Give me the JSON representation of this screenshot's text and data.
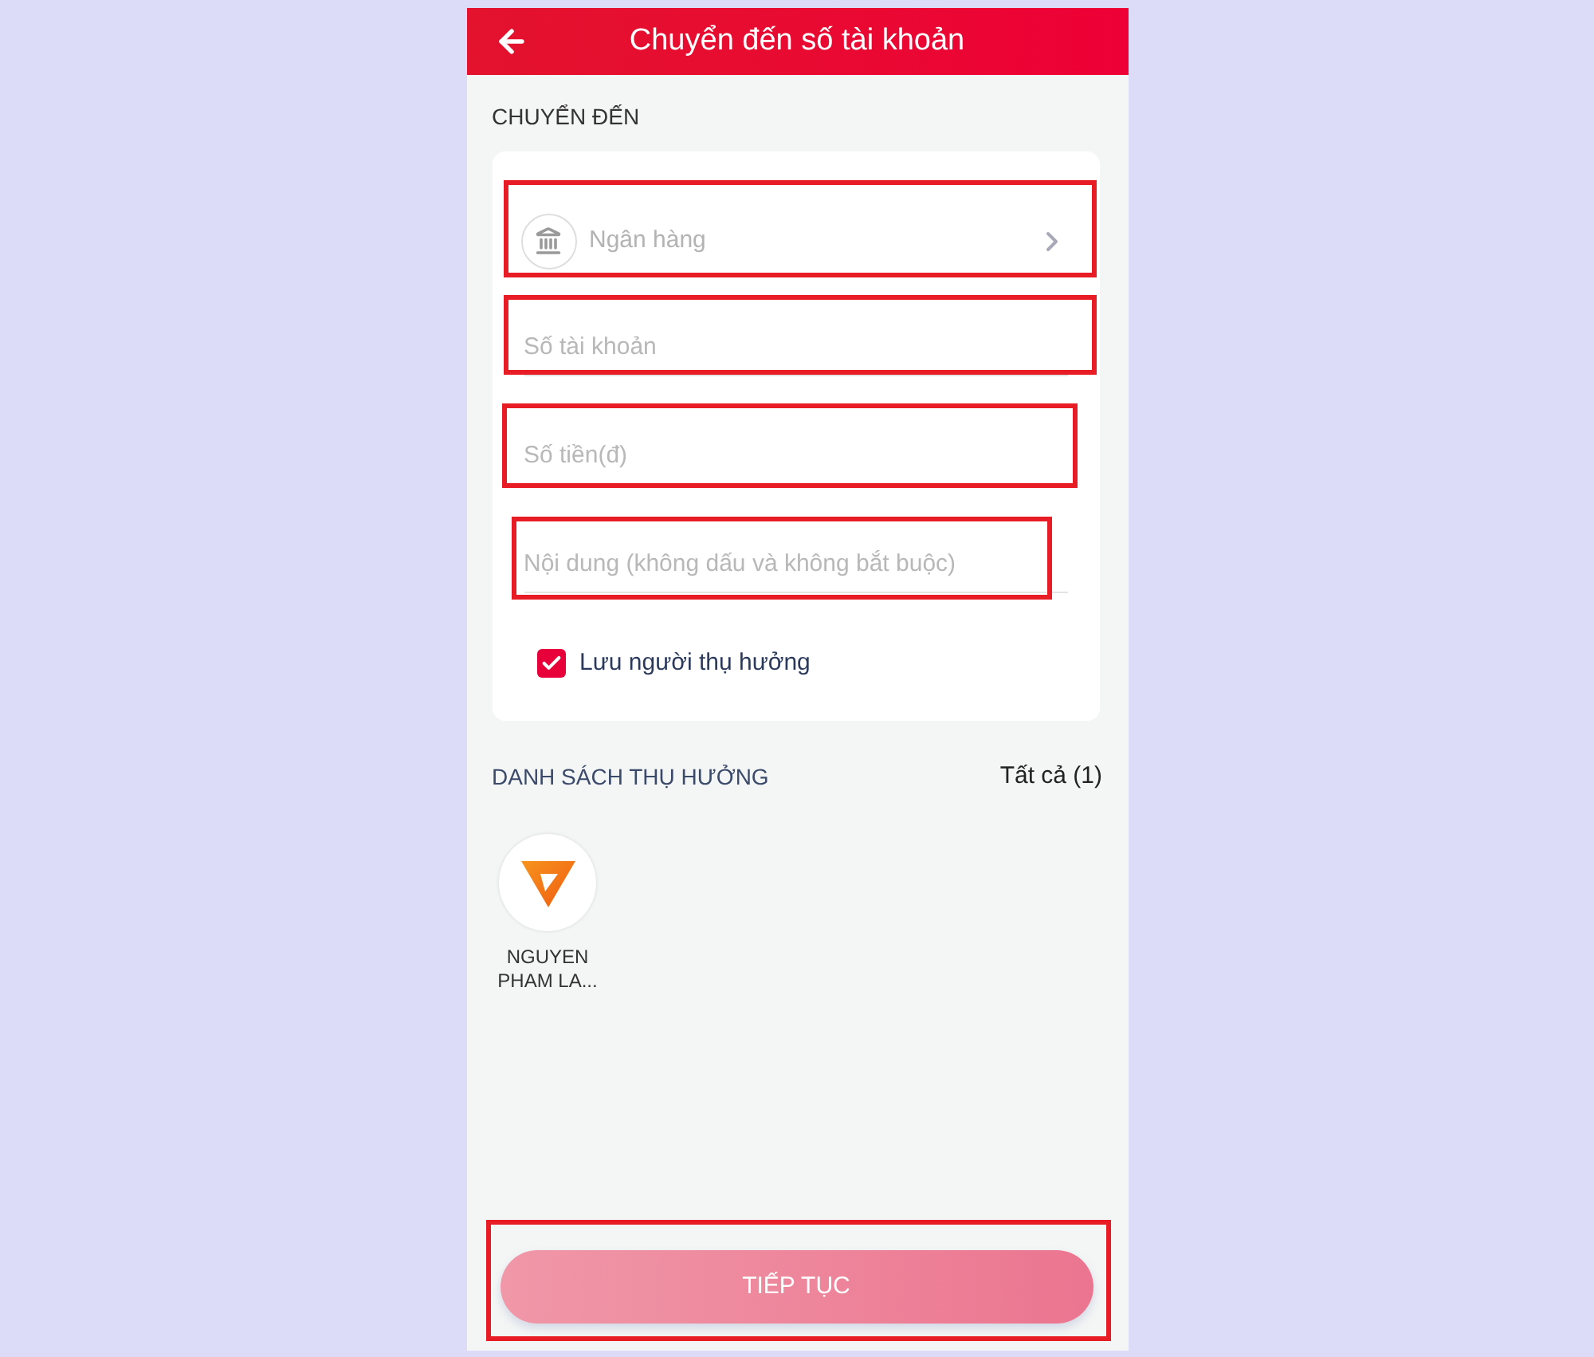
{
  "header": {
    "title": "Chuyển đến số tài khoản"
  },
  "section_label": "CHUYỂN ĐẾN",
  "form": {
    "fields": [
      {
        "kind": "select",
        "placeholder": "Ngân hàng",
        "highlighted": true
      },
      {
        "kind": "text",
        "placeholder": "Số tài khoản",
        "highlighted": true
      },
      {
        "kind": "text",
        "placeholder": "Số tiền(đ)",
        "highlighted": true
      },
      {
        "kind": "text",
        "placeholder": "Nội dung (không dấu và không bắt buộc)",
        "highlighted": true
      }
    ],
    "save_beneficiary": {
      "label": "Lưu người thụ hưởng",
      "checked": true
    }
  },
  "beneficiaries": {
    "title": "DANH SÁCH THỤ HƯỞNG",
    "see_all": "Tất cả (1)",
    "items": [
      {
        "name": "NGUYEN PHAM LA..."
      }
    ]
  },
  "continue_button": {
    "label": "TIẾP TỤC",
    "highlighted": true,
    "disabled": true
  }
}
